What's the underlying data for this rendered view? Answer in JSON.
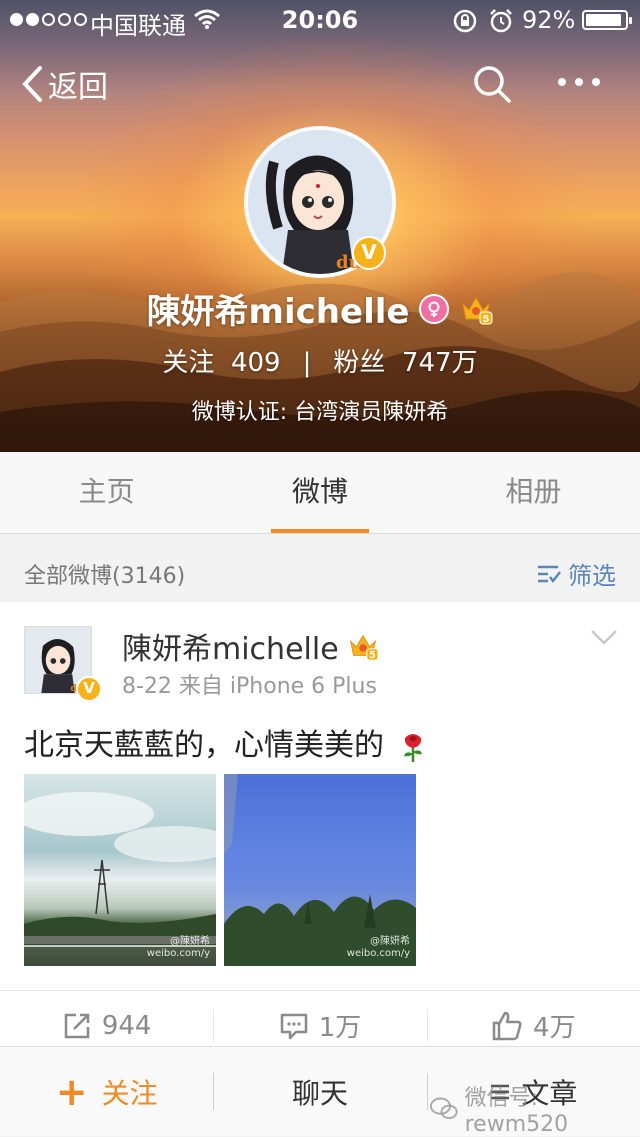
{
  "status_bar": {
    "carrier": "中国联通",
    "time": "20:06",
    "battery_percent": "92%",
    "battery_level": 0.92,
    "signal_dots_filled": 2,
    "signal_dots_total": 5
  },
  "header": {
    "back_label": "返回",
    "name": "陳妍希michelle",
    "follow_label": "关注",
    "follow_count": "409",
    "stat_separator": "|",
    "fans_label": "粉丝",
    "fans_count": "747万",
    "verification": "微博认证: 台湾演员陳妍希",
    "avatar_mark": "du",
    "verified_badge": "V",
    "member_badge": "5"
  },
  "tabs": [
    {
      "label": "主页",
      "active": false
    },
    {
      "label": "微博",
      "active": true
    },
    {
      "label": "相册",
      "active": false
    }
  ],
  "filter_bar": {
    "count_label": "全部微博(3146)",
    "filter_label": "筛选"
  },
  "post": {
    "author": "陳妍希michelle",
    "meta": "8-22  来自 iPhone 6 Plus",
    "text": "北京天藍藍的，心情美美的",
    "avatar_mark": "du",
    "verified_badge": "V",
    "member_badge": "5",
    "image_watermark": "@陳妍希",
    "image_watermark_url": "weibo.com/y",
    "actions": {
      "repost": "944",
      "comment": "1万",
      "like": "4万"
    }
  },
  "bottom_bar": {
    "follow_plus": "+",
    "follow_label": "关注",
    "chat_label": "聊天",
    "article_label": "文章"
  },
  "watermark": "微信号: rewm520",
  "colors": {
    "accent": "#f08a24",
    "link": "#5b86b8",
    "verified": "#f7b21a",
    "gender_female": "#f16ea2"
  }
}
